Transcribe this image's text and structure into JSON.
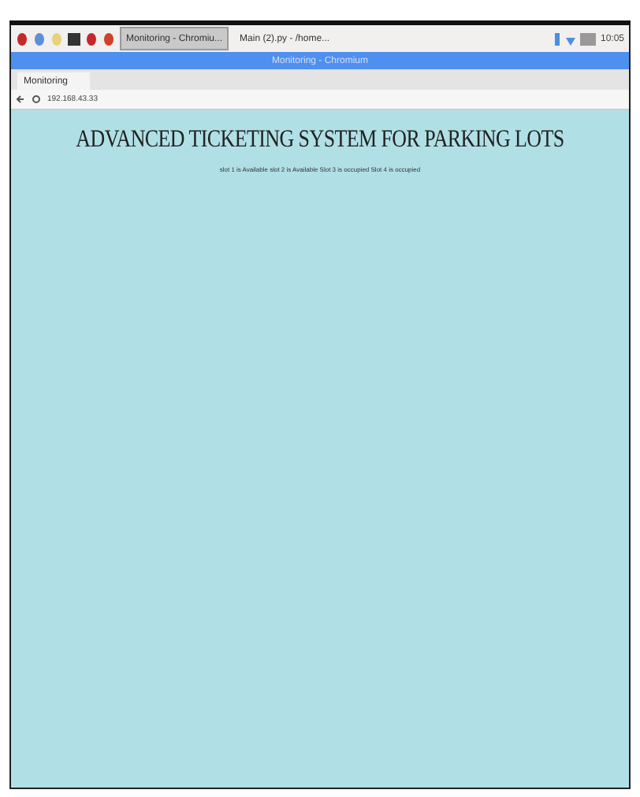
{
  "taskbar": {
    "tasks": [
      {
        "label": "Monitoring - Chromiu...",
        "selected": true
      },
      {
        "label": "Main (2).py - /home...",
        "selected": false
      }
    ],
    "clock": "10:05"
  },
  "window": {
    "title": "Monitoring - Chromium"
  },
  "tabs": [
    {
      "label": "Monitoring",
      "selected": true
    }
  ],
  "address": {
    "url": "192.168.43.33"
  },
  "page": {
    "heading": "ADVANCED TICKETING SYSTEM FOR PARKING LOTS",
    "status": "slot 1 is Available slot 2 is Available Slot 3 is occupied Slot 4 is occupied"
  }
}
